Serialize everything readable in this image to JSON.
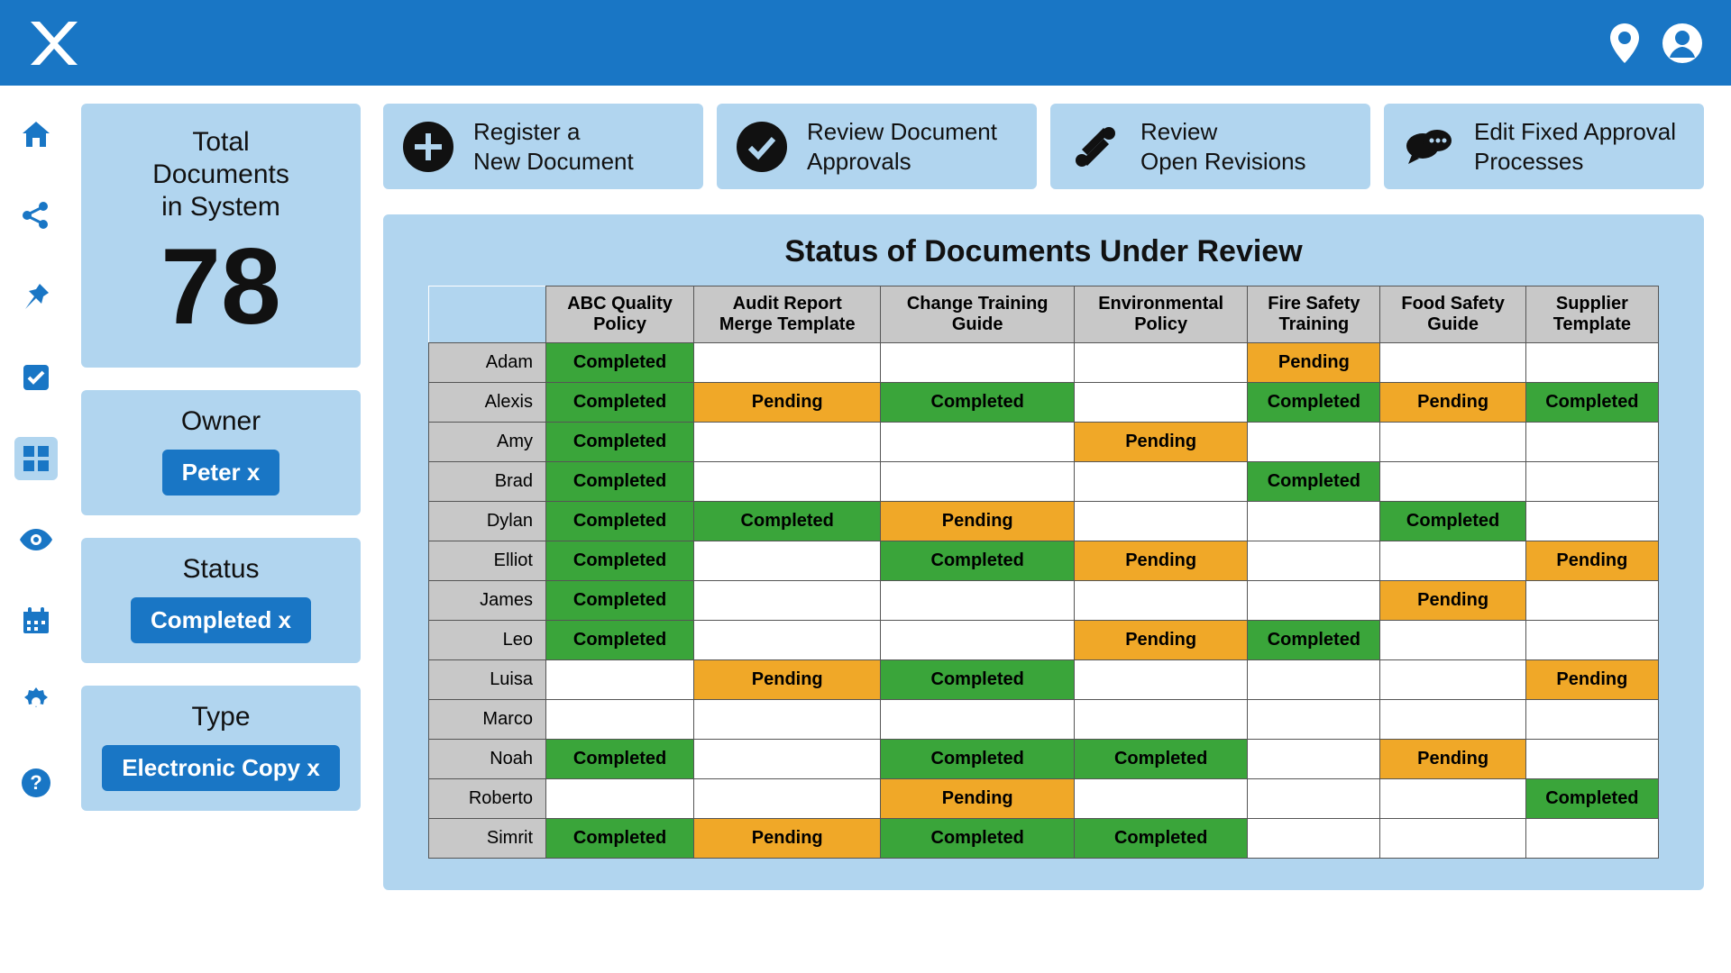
{
  "header": {
    "brand": "X"
  },
  "sidebar": {
    "items": [
      {
        "name": "home-icon"
      },
      {
        "name": "share-icon"
      },
      {
        "name": "pin-icon"
      },
      {
        "name": "checkbox-icon"
      },
      {
        "name": "dashboard-icon"
      },
      {
        "name": "eye-icon"
      },
      {
        "name": "calendar-icon"
      },
      {
        "name": "gear-icon"
      },
      {
        "name": "help-icon"
      }
    ],
    "active_index": 4
  },
  "total_docs": {
    "label_line1": "Total",
    "label_line2": "Documents",
    "label_line3": "in System",
    "count": "78"
  },
  "filters": [
    {
      "title": "Owner",
      "chip": "Peter x"
    },
    {
      "title": "Status",
      "chip": "Completed x"
    },
    {
      "title": "Type",
      "chip": "Electronic Copy x"
    }
  ],
  "actions": [
    {
      "icon": "plus-icon",
      "label_line1": "Register a",
      "label_line2": "New Document"
    },
    {
      "icon": "check-icon",
      "label_line1": "Review Document",
      "label_line2": "Approvals"
    },
    {
      "icon": "tools-icon",
      "label_line1": "Review",
      "label_line2": "Open Revisions"
    },
    {
      "icon": "chat-icon",
      "label_line1": "Edit Fixed Approval",
      "label_line2": "Processes"
    }
  ],
  "table": {
    "title": "Status of Documents Under Review",
    "columns": [
      "ABC Quality Policy",
      "Audit Report Merge Template",
      "Change Training Guide",
      "Environmental Policy",
      "Fire Safety Training",
      "Food Safety Guide",
      "Supplier Template"
    ],
    "rows": [
      {
        "name": "Adam",
        "cells": [
          "Completed",
          "",
          "",
          "",
          "Pending",
          "",
          ""
        ]
      },
      {
        "name": "Alexis",
        "cells": [
          "Completed",
          "Pending",
          "Completed",
          "",
          "Completed",
          "Pending",
          "Completed"
        ]
      },
      {
        "name": "Amy",
        "cells": [
          "Completed",
          "",
          "",
          "Pending",
          "",
          "",
          ""
        ]
      },
      {
        "name": "Brad",
        "cells": [
          "Completed",
          "",
          "",
          "",
          "Completed",
          "",
          ""
        ]
      },
      {
        "name": "Dylan",
        "cells": [
          "Completed",
          "Completed",
          "Pending",
          "",
          "",
          "Completed",
          ""
        ]
      },
      {
        "name": "Elliot",
        "cells": [
          "Completed",
          "",
          "Completed",
          "Pending",
          "",
          "",
          "Pending"
        ]
      },
      {
        "name": "James",
        "cells": [
          "Completed",
          "",
          "",
          "",
          "",
          "Pending",
          ""
        ]
      },
      {
        "name": "Leo",
        "cells": [
          "Completed",
          "",
          "",
          "Pending",
          "Completed",
          "",
          ""
        ]
      },
      {
        "name": "Luisa",
        "cells": [
          "",
          "Pending",
          "Completed",
          "",
          "",
          "",
          "Pending"
        ]
      },
      {
        "name": "Marco",
        "cells": [
          "",
          "",
          "",
          "",
          "",
          "",
          ""
        ]
      },
      {
        "name": "Noah",
        "cells": [
          "Completed",
          "",
          "Completed",
          "Completed",
          "",
          "Pending",
          ""
        ]
      },
      {
        "name": "Roberto",
        "cells": [
          "",
          "",
          "Pending",
          "",
          "",
          "",
          "Completed"
        ]
      },
      {
        "name": "Simrit",
        "cells": [
          "Completed",
          "Pending",
          "Completed",
          "Completed",
          "",
          "",
          ""
        ]
      }
    ]
  },
  "status_labels": {
    "completed": "Completed",
    "pending": "Pending"
  },
  "colors": {
    "brand_blue": "#1976c5",
    "light_blue": "#b1d5ef",
    "completed": "#3aa53a",
    "pending": "#f0a828"
  }
}
